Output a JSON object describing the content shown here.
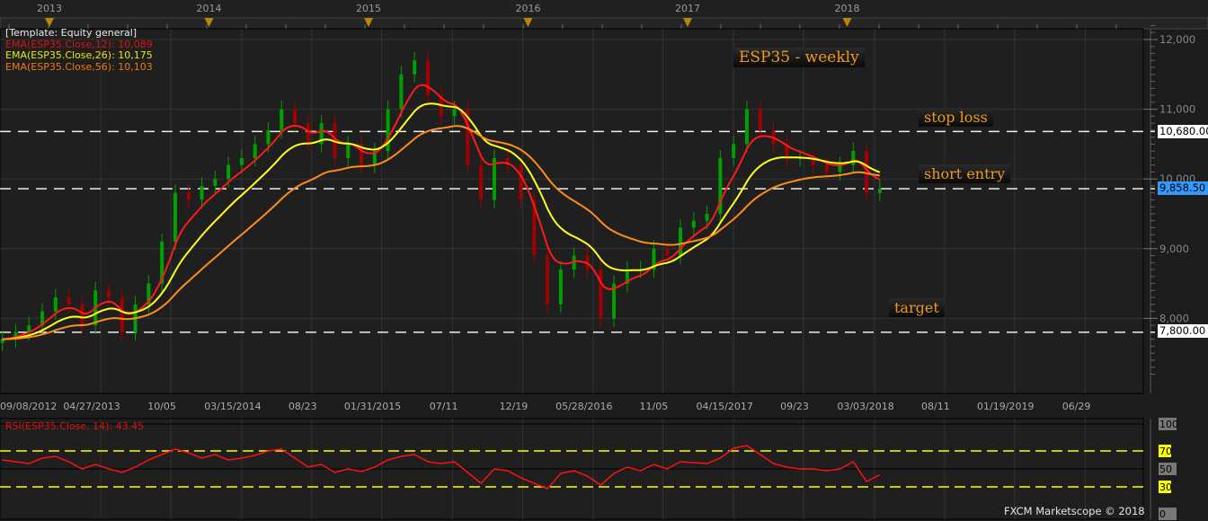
{
  "legend": {
    "template": "[Template: Equity general]",
    "ema12": "EMA(ESP35.Close,12): 10,089",
    "ema26": "EMA(ESP35.Close,26): 10,175",
    "ema56": "EMA(ESP35.Close,56): 10,103"
  },
  "annotations": {
    "title": "ESP35 - weekly",
    "stop_loss": "stop loss",
    "short_entry": "short entry",
    "target": "target"
  },
  "price_labels": {
    "stop_loss": "10,680.00",
    "current": "9,858.50",
    "target": "7,800.00"
  },
  "rsi_label": "RSI(ESP35.Close, 14): 43.45",
  "footer": "FXCM Marketscope © 2018",
  "colors": {
    "ema12": "#ff1a1a",
    "ema26": "#ffff1a",
    "ema56": "#ff8c1a",
    "up_candle": "#00a000",
    "down_candle": "#a00000",
    "current_price": "#3399ff",
    "annotation_text": "#f09a1a"
  },
  "chart_data": [
    {
      "type": "candlestick",
      "title": "ESP35 - weekly",
      "years": [
        "2013",
        "2014",
        "2015",
        "2016",
        "2017",
        "2018"
      ],
      "x_tick_labels": [
        {
          "label": "09/08/2012",
          "date": "2012-09-08"
        },
        {
          "label": "04/27/2013",
          "date": "2013-04-27"
        },
        {
          "label": "10/05",
          "date": "2013-10-05"
        },
        {
          "label": "03/15/2014",
          "date": "2014-03-15"
        },
        {
          "label": "08/23",
          "date": "2014-08-23"
        },
        {
          "label": "01/31/2015",
          "date": "2015-01-31"
        },
        {
          "label": "07/11",
          "date": "2015-07-11"
        },
        {
          "label": "12/19",
          "date": "2015-12-19"
        },
        {
          "label": "05/28/2016",
          "date": "2016-05-28"
        },
        {
          "label": "11/05",
          "date": "2016-11-05"
        },
        {
          "label": "04/15/2017",
          "date": "2017-04-15"
        },
        {
          "label": "09/23",
          "date": "2017-09-23"
        },
        {
          "label": "03/03/2018",
          "date": "2018-03-03"
        },
        {
          "label": "08/11",
          "date": "2018-08-11"
        },
        {
          "label": "01/19/2019",
          "date": "2019-01-19"
        },
        {
          "label": "06/29",
          "date": "2019-06-29"
        }
      ],
      "y_ticks": [
        {
          "value": 12000,
          "label": "12,000"
        },
        {
          "value": 11000,
          "label": "11,000"
        },
        {
          "value": 10000,
          "label": "10,000"
        },
        {
          "value": 9000,
          "label": "9,000"
        },
        {
          "value": 8000,
          "label": "8,000"
        }
      ],
      "ylim": [
        7100,
        12300
      ],
      "horizontal_lines": [
        {
          "name": "stop loss",
          "value": 10680
        },
        {
          "name": "short entry",
          "value": 9858.5
        },
        {
          "name": "target",
          "value": 7800
        }
      ],
      "dates": [
        "2012-09",
        "2012-10",
        "2012-11",
        "2012-12",
        "2013-01",
        "2013-02",
        "2013-03",
        "2013-04",
        "2013-05",
        "2013-06",
        "2013-07",
        "2013-08",
        "2013-09",
        "2013-10",
        "2013-11",
        "2013-12",
        "2014-01",
        "2014-02",
        "2014-03",
        "2014-04",
        "2014-05",
        "2014-06",
        "2014-07",
        "2014-08",
        "2014-09",
        "2014-10",
        "2014-11",
        "2014-12",
        "2015-01",
        "2015-02",
        "2015-03",
        "2015-04",
        "2015-05",
        "2015-06",
        "2015-07",
        "2015-08",
        "2015-09",
        "2015-10",
        "2015-11",
        "2015-12",
        "2016-01",
        "2016-02",
        "2016-03",
        "2016-04",
        "2016-05",
        "2016-06",
        "2016-07",
        "2016-08",
        "2016-09",
        "2016-10",
        "2016-11",
        "2016-12",
        "2017-01",
        "2017-02",
        "2017-03",
        "2017-04",
        "2017-05",
        "2017-06",
        "2017-07",
        "2017-08",
        "2017-09",
        "2017-10",
        "2017-11",
        "2017-12",
        "2018-01",
        "2018-02",
        "2018-03"
      ],
      "close": [
        7700,
        7800,
        7900,
        8100,
        8300,
        8200,
        7900,
        8400,
        8300,
        7800,
        8200,
        8500,
        9100,
        9800,
        9700,
        9900,
        10000,
        10200,
        10300,
        10500,
        10700,
        11000,
        10800,
        10500,
        10800,
        10300,
        10500,
        10200,
        10400,
        11000,
        11500,
        11700,
        11200,
        10900,
        11000,
        10200,
        9700,
        10300,
        10200,
        9700,
        8900,
        8200,
        8700,
        8900,
        8700,
        8000,
        8500,
        8700,
        8700,
        9000,
        8900,
        9300,
        9400,
        9500,
        10300,
        10500,
        11000,
        10700,
        10500,
        10300,
        10300,
        10200,
        10100,
        10200,
        10400,
        9800,
        9858.5
      ],
      "indicators": [
        {
          "name": "EMA(ESP35.Close,12)",
          "period_weeks": 12,
          "last": 10089
        },
        {
          "name": "EMA(ESP35.Close,26)",
          "period_weeks": 26,
          "last": 10175
        },
        {
          "name": "EMA(ESP35.Close,56)",
          "period_weeks": 56,
          "last": 10103
        }
      ]
    },
    {
      "type": "line",
      "title": "RSI(ESP35.Close, 14)",
      "ylim": [
        0,
        100
      ],
      "y_ticks": [
        0,
        30,
        50,
        70,
        100
      ],
      "levels": [
        30,
        70
      ],
      "values": [
        60,
        58,
        56,
        62,
        64,
        58,
        50,
        55,
        50,
        46,
        52,
        60,
        66,
        72,
        68,
        62,
        66,
        60,
        62,
        65,
        70,
        72,
        62,
        52,
        55,
        46,
        50,
        47,
        52,
        60,
        64,
        66,
        58,
        56,
        58,
        46,
        34,
        50,
        48,
        40,
        34,
        28,
        45,
        48,
        42,
        32,
        45,
        52,
        48,
        55,
        50,
        58,
        57,
        56,
        62,
        73,
        76,
        66,
        56,
        52,
        50,
        50,
        48,
        50,
        58,
        36,
        43.45
      ]
    }
  ]
}
